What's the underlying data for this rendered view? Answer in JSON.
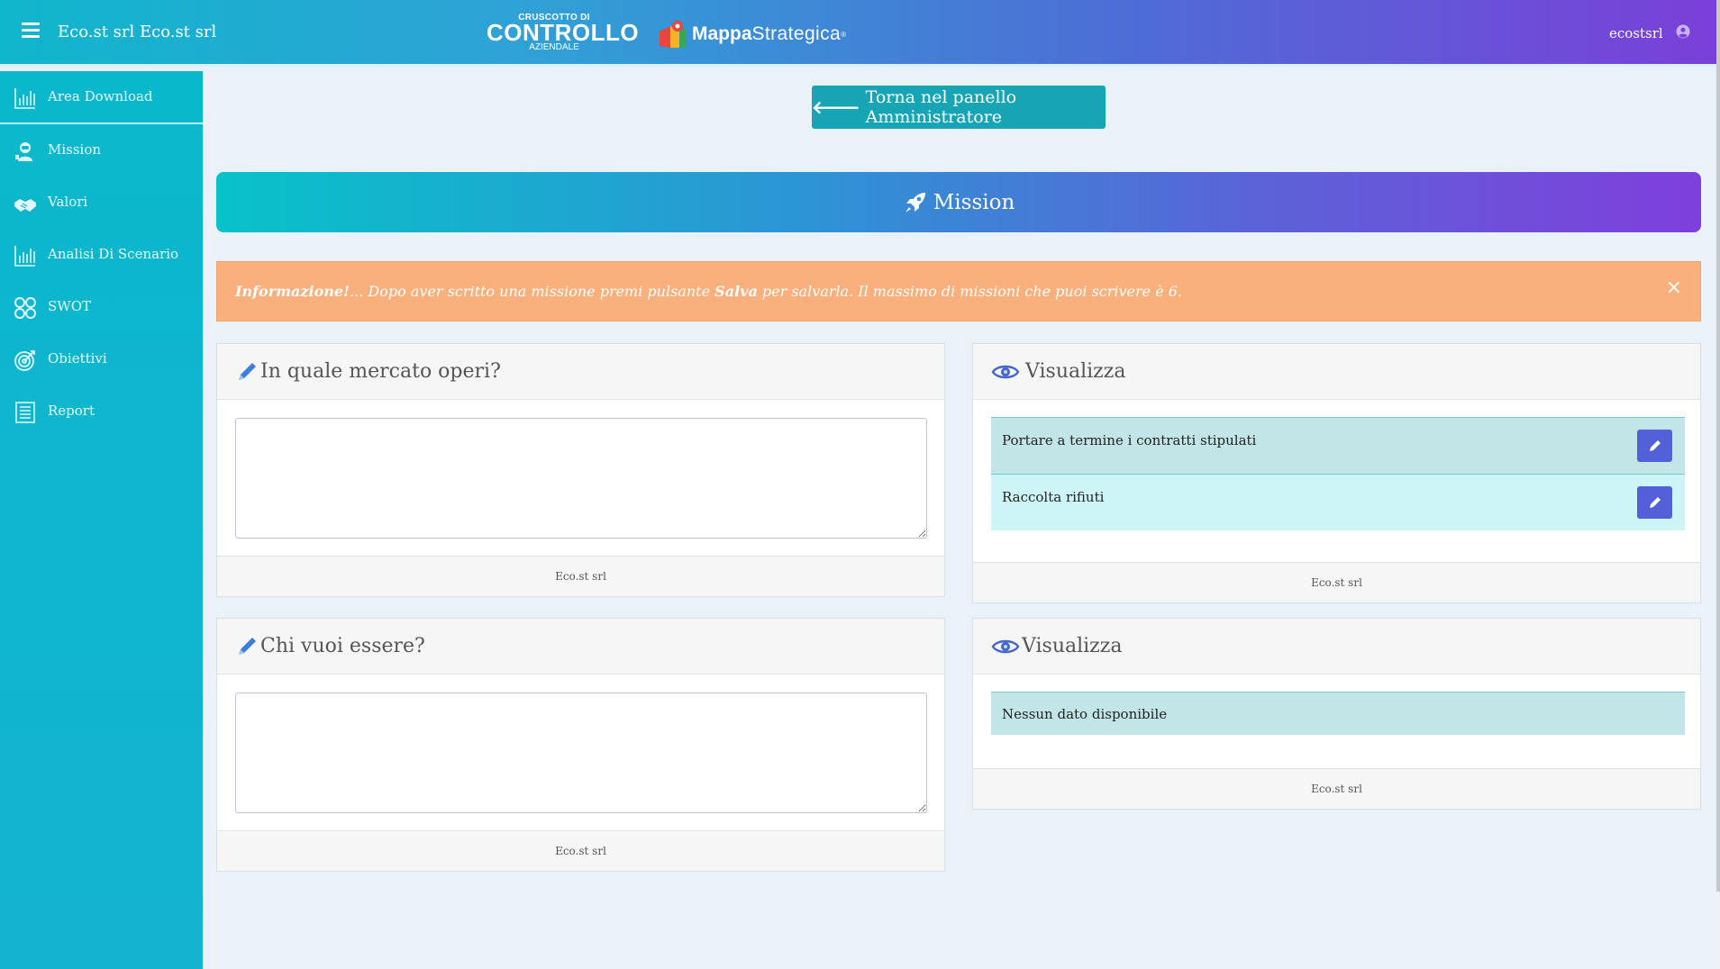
{
  "header": {
    "company_name": "Eco.st srl Eco.st srl",
    "logo1": {
      "top": "CRUSCOTTO DI",
      "main": "CONTROLLO",
      "bottom": "AZIENDALE"
    },
    "logo2": {
      "part1": "Mappa",
      "part2": "Strategica",
      "reg": "®"
    },
    "username": "ecostsrl"
  },
  "sidebar": {
    "items": [
      {
        "label": "Area Download",
        "icon": "bar-chart-icon"
      },
      {
        "label": "Mission",
        "icon": "astronaut-icon"
      },
      {
        "label": "Valori",
        "icon": "handshake-icon"
      },
      {
        "label": "Analisi Di Scenario",
        "icon": "bar-chart-icon"
      },
      {
        "label": "SWOT",
        "icon": "swot-icon"
      },
      {
        "label": "Obiettivi",
        "icon": "target-icon"
      },
      {
        "label": "Report",
        "icon": "document-icon"
      }
    ]
  },
  "main": {
    "back_button": "Torna nel panello Amministratore",
    "banner_title": "Mission",
    "alert": {
      "strong": "Informazione!",
      "text1": "... Dopo aver scritto una missione premi pulsante ",
      "bold2": "Salva",
      "text2": " per salvarla. Il massimo di missioni che puoi scrivere è 6.",
      "close": "×"
    },
    "cards": {
      "q1": {
        "title": "In quale mercato operi?",
        "textarea_value": "",
        "footer": "Eco.st srl"
      },
      "v1": {
        "title": "Visualizza",
        "items": [
          "Portare a termine i contratti stipulati",
          "Raccolta rifiuti"
        ],
        "footer": "Eco.st srl"
      },
      "q2": {
        "title": "Chi vuoi essere?",
        "textarea_value": "",
        "footer": "Eco.st srl"
      },
      "v2": {
        "title": "Visualizza",
        "empty_text": "Nessun dato disponibile",
        "footer": "Eco.st srl"
      }
    }
  },
  "colors": {
    "sidebar": "#0ab8cc",
    "primary_button": "#17a5b5",
    "edit_button": "#5460d8",
    "alert": "#f9b07c",
    "gradient_start": "#08c2c9",
    "gradient_end": "#7f3fdc"
  }
}
